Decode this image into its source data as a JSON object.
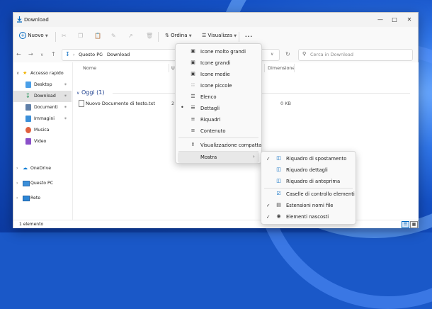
{
  "window": {
    "title": "Download"
  },
  "toolbar": {
    "new_label": "Nuovo",
    "sort_label": "Ordina",
    "view_label": "Visualizza",
    "more_label": "..."
  },
  "address": {
    "segments": [
      "Questo PC",
      "Download"
    ],
    "search_placeholder": "Cerca in Download"
  },
  "sidebar": {
    "items": [
      {
        "label": "Accesso rapido",
        "icon": "star-icon"
      },
      {
        "label": "Desktop",
        "icon": "desktop-folder-icon"
      },
      {
        "label": "Download",
        "icon": "download-folder-icon"
      },
      {
        "label": "Documenti",
        "icon": "documents-folder-icon"
      },
      {
        "label": "Immagini",
        "icon": "pictures-folder-icon"
      },
      {
        "label": "Musica",
        "icon": "music-folder-icon"
      },
      {
        "label": "Video",
        "icon": "video-folder-icon"
      },
      {
        "label": "OneDrive",
        "icon": "cloud-icon"
      },
      {
        "label": "Questo PC",
        "icon": "computer-icon"
      },
      {
        "label": "Rete",
        "icon": "network-icon"
      }
    ]
  },
  "columns": {
    "name": "Nome",
    "modified": "U",
    "size": "Dimensione"
  },
  "group": {
    "label": "Oggi (1)"
  },
  "files": [
    {
      "name": "Nuovo Documento di testo.txt",
      "date": "2",
      "size": "0 KB"
    }
  ],
  "view_menu": {
    "items": [
      {
        "label": "Icone molto grandi",
        "icon": "monitor-icon",
        "checked": false
      },
      {
        "label": "Icone grandi",
        "icon": "monitor-icon",
        "checked": false
      },
      {
        "label": "Icone medie",
        "icon": "monitor-icon",
        "checked": false
      },
      {
        "label": "Icone piccole",
        "icon": "small-icons-icon",
        "checked": false
      },
      {
        "label": "Elenco",
        "icon": "list-icon",
        "checked": false
      },
      {
        "label": "Dettagli",
        "icon": "details-icon",
        "checked": true
      },
      {
        "label": "Riquadri",
        "icon": "tiles-icon",
        "checked": false
      },
      {
        "label": "Contenuto",
        "icon": "content-icon",
        "checked": false
      },
      {
        "label": "Visualizzazione compatta",
        "icon": "compact-icon",
        "checked": false
      },
      {
        "label": "Mostra",
        "icon": "",
        "checked": false
      }
    ]
  },
  "show_menu": {
    "items": [
      {
        "label": "Riquadro di spostamento",
        "checked": true
      },
      {
        "label": "Riquadro dettagli",
        "checked": false
      },
      {
        "label": "Riquadro di anteprima",
        "checked": false
      },
      {
        "label": "Caselle di controllo elementi",
        "checked": false
      },
      {
        "label": "Estensioni nomi file",
        "checked": true
      },
      {
        "label": "Elementi nascosti",
        "checked": true
      }
    ]
  },
  "status": {
    "text": "1 elemento"
  },
  "colors": {
    "accent": "#0067c0",
    "folder": "#f5c242",
    "selected_bg": "#e2e2e2"
  }
}
